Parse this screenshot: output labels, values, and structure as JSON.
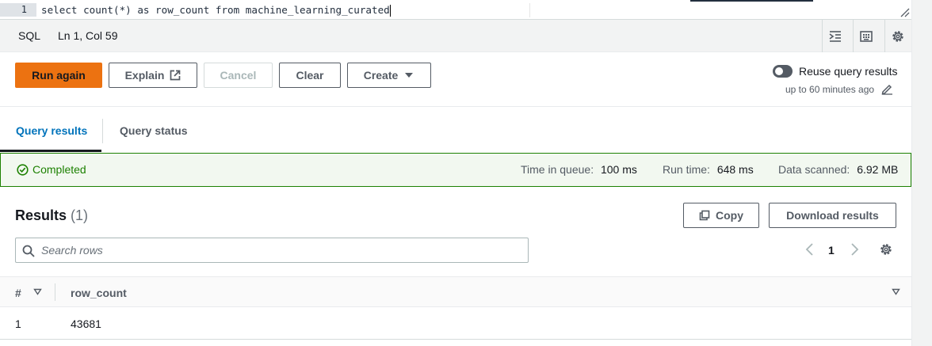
{
  "editor": {
    "line_number": "1",
    "code": "select count(*) as row_count from machine_learning_curated"
  },
  "status_bar": {
    "language": "SQL",
    "position": "Ln 1, Col 59",
    "icons": [
      "indent-icon",
      "keyboard-icon",
      "gear-icon"
    ]
  },
  "toolbar": {
    "run_label": "Run again",
    "explain_label": "Explain",
    "cancel_label": "Cancel",
    "clear_label": "Clear",
    "create_label": "Create",
    "reuse_label": "Reuse query results",
    "reuse_sub": "up to 60 minutes ago",
    "reuse_enabled": false,
    "accent_color": "#ec7211"
  },
  "tabs": [
    {
      "label": "Query results",
      "active": true
    },
    {
      "label": "Query status",
      "active": false
    }
  ],
  "banner": {
    "status": "Completed",
    "time_in_queue_label": "Time in queue:",
    "time_in_queue": "100 ms",
    "run_time_label": "Run time:",
    "run_time": "648 ms",
    "data_scanned_label": "Data scanned:",
    "data_scanned": "6.92 MB",
    "status_color": "#1d8102"
  },
  "results": {
    "title": "Results",
    "count": "(1)",
    "copy_label": "Copy",
    "download_label": "Download results",
    "search_placeholder": "Search rows",
    "page": "1",
    "columns": [
      "#",
      "row_count"
    ],
    "rows": [
      [
        "1",
        "43681"
      ]
    ]
  }
}
